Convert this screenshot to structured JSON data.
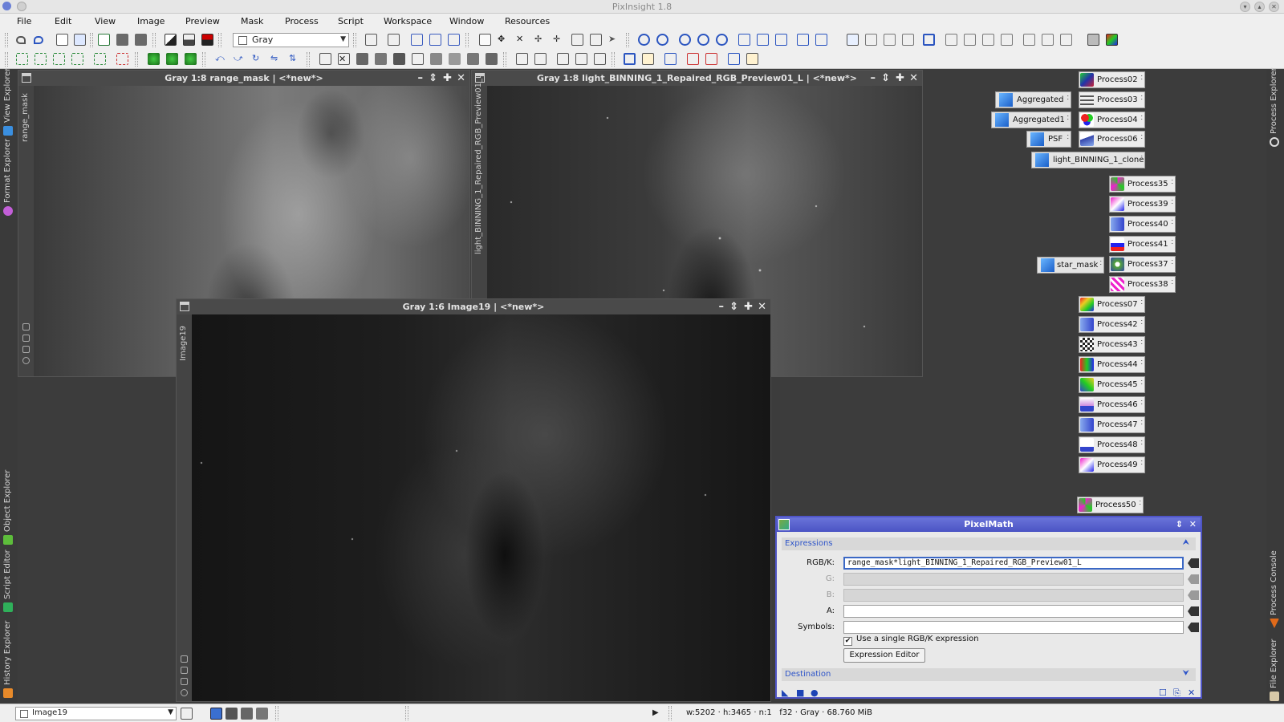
{
  "app": {
    "title": "PixInsight 1.8"
  },
  "menu": [
    "File",
    "Edit",
    "View",
    "Image",
    "Preview",
    "Mask",
    "Process",
    "Script",
    "Workspace",
    "Window",
    "Resources"
  ],
  "toolbar": {
    "color_mode": "Gray"
  },
  "left_panel_tabs": [
    "View Explorer",
    "Format Explorer",
    "Object Explorer",
    "Script Editor",
    "History Explorer"
  ],
  "right_panel_tabs": [
    "Process Explorer",
    "Process Console",
    "File Explorer"
  ],
  "windows": {
    "range_mask": {
      "title": "Gray 1:8 range_mask | <*new*>",
      "id": "range_mask"
    },
    "preview": {
      "title": "Gray 1:8 light_BINNING_1_Repaired_RGB_Preview01_L | <*new*>",
      "id": "light_BINNING_1_Repaired_RGB_Preview01_L"
    },
    "image19": {
      "title": "Gray 1:6 Image19 | <*new*>",
      "id": "Image19"
    }
  },
  "process_icons": {
    "aggregated": "Aggregated",
    "aggregated1": "Aggregated1",
    "psf": "PSF",
    "light_clone": "light_BINNING_1_clone",
    "star_mask": "star_mask",
    "p02": "Process02",
    "p03": "Process03",
    "p04": "Process04",
    "p06": "Process06",
    "p35": "Process35",
    "p39": "Process39",
    "p40": "Process40",
    "p41": "Process41",
    "p37": "Process37",
    "p38": "Process38",
    "p07": "Process07",
    "p42": "Process42",
    "p43": "Process43",
    "p44": "Process44",
    "p45": "Process45",
    "p46": "Process46",
    "p47": "Process47",
    "p48": "Process48",
    "p49": "Process49",
    "p50": "Process50"
  },
  "pixelmath": {
    "title": "PixelMath",
    "expressions_label": "Expressions",
    "rgbk_label": "RGB/K:",
    "rgbk_value": "range_mask*light_BINNING_1_Repaired_RGB_Preview01_L",
    "g_label": "G:",
    "b_label": "B:",
    "a_label": "A:",
    "symbols_label": "Symbols:",
    "single_expression_label": "Use a single RGB/K expression",
    "single_expression_checked": true,
    "expression_editor_label": "Expression Editor",
    "destination_label": "Destination"
  },
  "statusbar": {
    "current_view": "Image19",
    "info": "w:5202 · h:3465 · n:1   f32 · Gray · 68.760 MiB"
  }
}
